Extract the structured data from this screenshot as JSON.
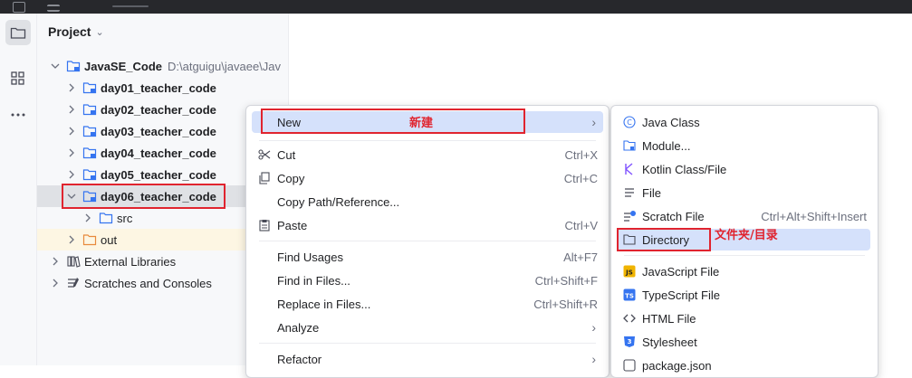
{
  "project_panel": {
    "title": "Project",
    "tree": [
      {
        "label": "JavaSE_Code",
        "path": "D:\\atguigu\\javaee\\Jav"
      },
      {
        "label": "day01_teacher_code"
      },
      {
        "label": "day02_teacher_code"
      },
      {
        "label": "day03_teacher_code"
      },
      {
        "label": "day04_teacher_code"
      },
      {
        "label": "day05_teacher_code"
      },
      {
        "label": "day06_teacher_code"
      },
      {
        "label": "src"
      },
      {
        "label": "out"
      },
      {
        "label": "External Libraries"
      },
      {
        "label": "Scratches and Consoles"
      }
    ]
  },
  "context_menu": {
    "new": "New",
    "cut": {
      "label": "Cut",
      "shortcut": "Ctrl+X"
    },
    "copy": {
      "label": "Copy",
      "shortcut": "Ctrl+C"
    },
    "copy_path": "Copy Path/Reference...",
    "paste": {
      "label": "Paste",
      "shortcut": "Ctrl+V"
    },
    "find_usages": {
      "label": "Find Usages",
      "shortcut": "Alt+F7"
    },
    "find_in_files": {
      "label": "Find in Files...",
      "shortcut": "Ctrl+Shift+F"
    },
    "replace_in_files": {
      "label": "Replace in Files...",
      "shortcut": "Ctrl+Shift+R"
    },
    "analyze": "Analyze",
    "refactor": "Refactor"
  },
  "new_submenu": {
    "java_class": "Java Class",
    "module": "Module...",
    "kotlin": "Kotlin Class/File",
    "file": "File",
    "scratch": {
      "label": "Scratch File",
      "shortcut": "Ctrl+Alt+Shift+Insert"
    },
    "directory": "Directory",
    "javascript": "JavaScript File",
    "typescript": "TypeScript File",
    "html": "HTML File",
    "stylesheet": "Stylesheet",
    "package_json": "package.json"
  },
  "annotations": {
    "new_cn": "新建",
    "directory_cn": "文件夹/目录"
  },
  "colors": {
    "annotation_red": "#e0242f",
    "highlight": "#d5e1fb",
    "selection": "#dfe1e5",
    "module_blue": "#3574f0",
    "folder_orange": "#e88a3c"
  }
}
